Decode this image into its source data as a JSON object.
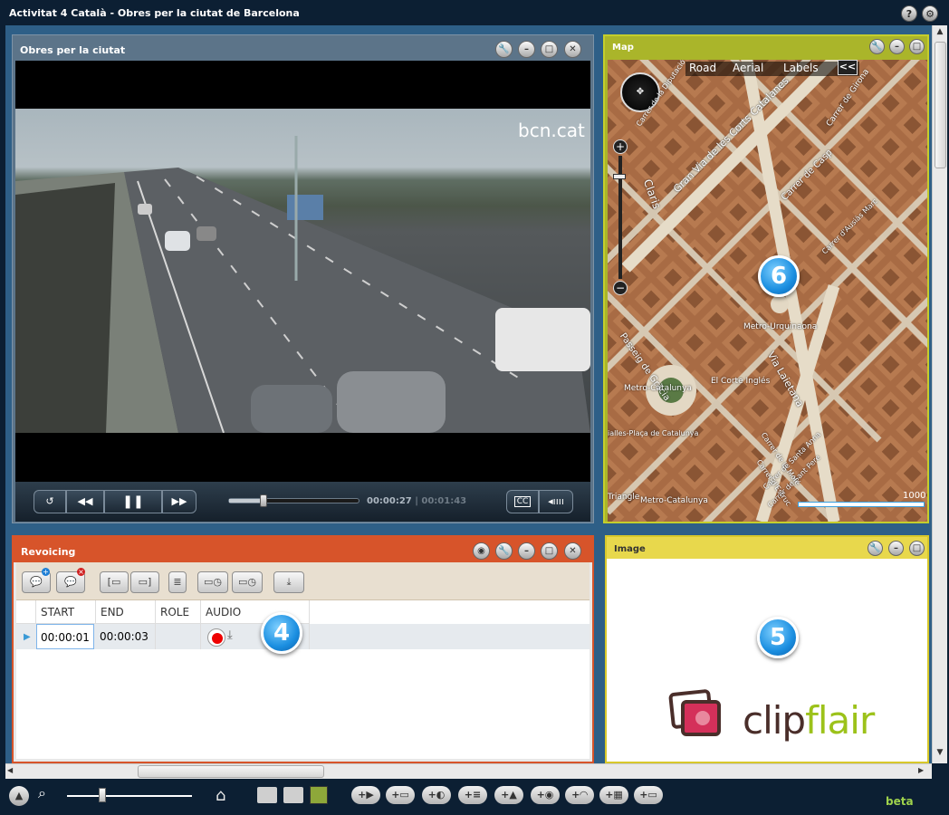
{
  "app": {
    "title": "Activitat 4 Català - Obres per la ciutat de Barcelona",
    "help_icon": "?",
    "settings_icon": "wrench"
  },
  "video": {
    "title": "Obres per la ciutat",
    "watermark": "bcn.cat",
    "current_time": "00:00:27",
    "separator": "|",
    "duration": "00:01:43",
    "progress": 0.26,
    "cc_label": "CC"
  },
  "map": {
    "title": "Map",
    "modes": [
      "Road",
      "Aerial",
      "Labels"
    ],
    "collapse": "<<",
    "scale": "1000",
    "streets": [
      {
        "text": "Gran Via de les Corts Catalanes"
      },
      {
        "text": "Carrer de Casp"
      },
      {
        "text": "Passeig de Gràcia"
      },
      {
        "text": "Via Laietana"
      },
      {
        "text": "Carrer de Girona"
      },
      {
        "text": "Carrer d'Ausiàs Marc"
      },
      {
        "text": "Carrer de la Diputació"
      },
      {
        "text": "Metro-Urquinaona"
      },
      {
        "text": "Metro-Catalunya"
      },
      {
        "text": "El Corte Inglés"
      },
      {
        "text": "Claris"
      },
      {
        "text": "Metro-Catalunya"
      },
      {
        "text": "ialles-Plaça de Catalunya"
      },
      {
        "text": "Carrer de Sant Pere"
      },
      {
        "text": "Carrer de la Molé"
      },
      {
        "text": "Carrer d'Estruc"
      },
      {
        "text": "Carrer de Santa Anna"
      },
      {
        "text": "Triangle"
      }
    ],
    "badge": "6"
  },
  "revoicing": {
    "title": "Revoicing",
    "columns": [
      "START",
      "END",
      "ROLE",
      "AUDIO"
    ],
    "rows": [
      {
        "start": "00:00:01",
        "end": "00:00:03",
        "role": ""
      }
    ],
    "badge": "4"
  },
  "image": {
    "title": "Image",
    "logo_text": "clipflair",
    "badge": "5"
  },
  "bottom": {
    "beta": "beta",
    "zoom_level": 0.25
  },
  "colors": {
    "workspace": "#2e5f87",
    "revoicing_accent": "#d7542a",
    "map_accent": "#c5ce2c",
    "image_accent": "#d8c82a"
  }
}
